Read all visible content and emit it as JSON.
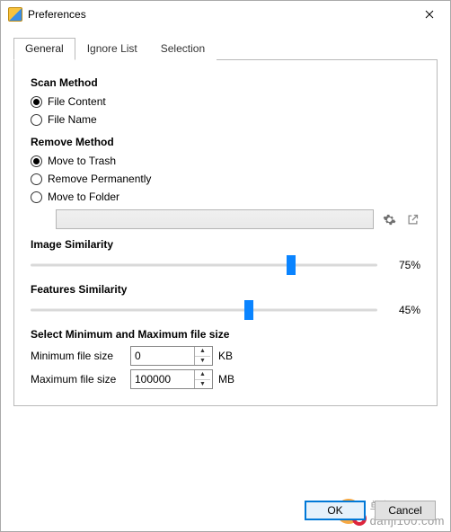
{
  "window": {
    "title": "Preferences"
  },
  "tabs": {
    "general": "General",
    "ignore_list": "Ignore List",
    "selection": "Selection"
  },
  "scan_method": {
    "heading": "Scan Method",
    "options": {
      "file_content": "File Content",
      "file_name": "File Name"
    },
    "selected": "file_content"
  },
  "remove_method": {
    "heading": "Remove Method",
    "options": {
      "move_to_trash": "Move to Trash",
      "remove_permanently": "Remove Permanently",
      "move_to_folder": "Move to Folder"
    },
    "selected": "move_to_trash",
    "folder_path": ""
  },
  "image_similarity": {
    "heading": "Image Similarity",
    "value": 75,
    "display": "75%"
  },
  "features_similarity": {
    "heading": "Features Similarity",
    "value": 45,
    "display": "45%"
  },
  "file_size": {
    "heading": "Select Minimum and Maximum file size",
    "min_label": "Minimum file  size",
    "min_value": "0",
    "min_unit": "KB",
    "max_label": "Maximum file size",
    "max_value": "100000",
    "max_unit": "MB"
  },
  "buttons": {
    "ok": "OK",
    "cancel": "Cancel"
  },
  "watermark": "单机100网\ndanji100.com"
}
